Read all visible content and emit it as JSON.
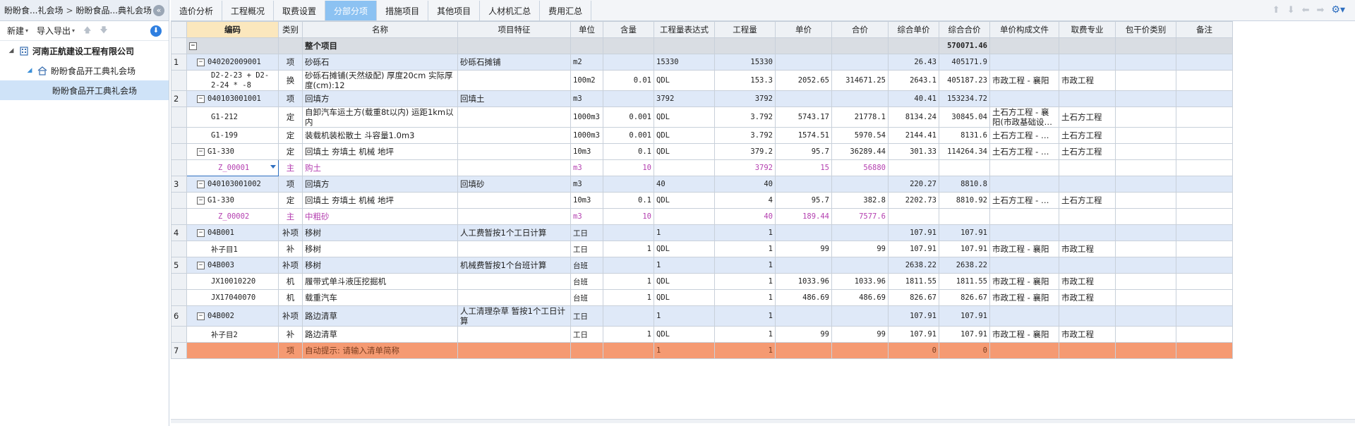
{
  "sidebar": {
    "breadcrumb": [
      "盼盼食...礼会场",
      "盼盼食品...典礼会场"
    ],
    "collapse_icon": "«",
    "toolbar": {
      "new_label": "新建",
      "import_export_label": "导入导出"
    },
    "tree": [
      {
        "label": "河南正航建设工程有限公司",
        "level": 0,
        "icon": "building-icon",
        "expanded": true
      },
      {
        "label": "盼盼食品开工典礼会场",
        "level": 1,
        "icon": "home-icon",
        "expanded": true
      },
      {
        "label": "盼盼食品开工典礼会场",
        "level": 2,
        "icon": "",
        "selected": true
      }
    ]
  },
  "tabs": [
    {
      "label": "造价分析"
    },
    {
      "label": "工程概况"
    },
    {
      "label": "取费设置"
    },
    {
      "label": "分部分项",
      "active": true
    },
    {
      "label": "措施项目"
    },
    {
      "label": "其他项目"
    },
    {
      "label": "人材机汇总"
    },
    {
      "label": "费用汇总"
    }
  ],
  "columns": [
    {
      "key": "rn",
      "label": ""
    },
    {
      "key": "code",
      "label": "编码"
    },
    {
      "key": "type",
      "label": "类别"
    },
    {
      "key": "name",
      "label": "名称"
    },
    {
      "key": "feature",
      "label": "项目特征"
    },
    {
      "key": "unit",
      "label": "单位"
    },
    {
      "key": "content",
      "label": "含量"
    },
    {
      "key": "expr",
      "label": "工程量表达式"
    },
    {
      "key": "qty",
      "label": "工程量"
    },
    {
      "key": "price",
      "label": "单价"
    },
    {
      "key": "total",
      "label": "合价"
    },
    {
      "key": "comp_price",
      "label": "综合单价"
    },
    {
      "key": "comp_total",
      "label": "综合合价"
    },
    {
      "key": "price_file",
      "label": "单价构成文件"
    },
    {
      "key": "fee_major",
      "label": "取费专业"
    },
    {
      "key": "lump_type",
      "label": "包干价类别"
    },
    {
      "key": "remark",
      "label": "备注"
    }
  ],
  "rows": [
    {
      "kind": "root",
      "rn": "",
      "code": "",
      "type": "",
      "name": "整个项目",
      "feature": "",
      "unit": "",
      "content": "",
      "expr": "",
      "qty": "",
      "price": "",
      "total": "",
      "comp_price": "",
      "comp_total": "570071.46",
      "price_file": "",
      "fee_major": ""
    },
    {
      "kind": "item",
      "rn": "1",
      "code": "040202009001",
      "type": "项",
      "name": "砂砾石",
      "feature": "砂砾石摊铺",
      "unit": "m2",
      "content": "",
      "expr": "15330",
      "qty": "15330",
      "price": "",
      "total": "",
      "comp_price": "26.43",
      "comp_total": "405171.9",
      "price_file": "",
      "fee_major": ""
    },
    {
      "kind": "sub",
      "tall": true,
      "rn": "",
      "code": "D2-2-23 + D2-2-24 * -8",
      "type": "换",
      "name": "砂砾石摊铺(天然级配) 厚度20cm  实际厚度(cm):12",
      "feature": "",
      "unit": "100m2",
      "content": "0.01",
      "expr": "QDL",
      "qty": "153.3",
      "price": "2052.65",
      "total": "314671.25",
      "comp_price": "2643.1",
      "comp_total": "405187.23",
      "price_file": "市政工程 - 襄阳",
      "fee_major": "市政工程"
    },
    {
      "kind": "item",
      "rn": "2",
      "code": "040103001001",
      "type": "项",
      "name": "回填方",
      "feature": "回填土",
      "unit": "m3",
      "content": "",
      "expr": "3792",
      "qty": "3792",
      "price": "",
      "total": "",
      "comp_price": "40.41",
      "comp_total": "153234.72",
      "price_file": "",
      "fee_major": ""
    },
    {
      "kind": "sub",
      "tall": true,
      "rn": "",
      "code": "G1-212",
      "type": "定",
      "name": "自卸汽车运土方(载重8t以内) 运距1km以内",
      "feature": "",
      "unit": "1000m3",
      "content": "0.001",
      "expr": "QDL",
      "qty": "3.792",
      "price": "5743.17",
      "total": "21778.1",
      "comp_price": "8134.24",
      "comp_total": "30845.04",
      "price_file": "土石方工程 - 襄阳(市政基础设…",
      "fee_major": "土石方工程"
    },
    {
      "kind": "sub",
      "rn": "",
      "code": "G1-199",
      "type": "定",
      "name": "装载机装松散土 斗容量1.0m3",
      "feature": "",
      "unit": "1000m3",
      "content": "0.001",
      "expr": "QDL",
      "qty": "3.792",
      "price": "1574.51",
      "total": "5970.54",
      "comp_price": "2144.41",
      "comp_total": "8131.6",
      "price_file": "土石方工程 - …",
      "fee_major": "土石方工程"
    },
    {
      "kind": "sub",
      "rn": "",
      "code": "G1-330",
      "type": "定",
      "name": "回填土 夯填土 机械 地坪",
      "feature": "",
      "unit": "10m3",
      "content": "0.1",
      "expr": "QDL",
      "qty": "379.2",
      "price": "95.7",
      "total": "36289.44",
      "comp_price": "301.33",
      "comp_total": "114264.34",
      "price_file": "土石方工程 - …",
      "fee_major": "土石方工程"
    },
    {
      "kind": "mat",
      "editing": true,
      "rn": "",
      "code": "Z_00001",
      "type": "主",
      "name": "购土",
      "feature": "",
      "unit": "m3",
      "content": "10",
      "expr": "",
      "qty": "3792",
      "price": "15",
      "total": "56880",
      "comp_price": "",
      "comp_total": "",
      "price_file": "",
      "fee_major": ""
    },
    {
      "kind": "item",
      "rn": "3",
      "code": "040103001002",
      "type": "项",
      "name": "回填方",
      "feature": "回填砂",
      "unit": "m3",
      "content": "",
      "expr": "40",
      "qty": "40",
      "price": "",
      "total": "",
      "comp_price": "220.27",
      "comp_total": "8810.8",
      "price_file": "",
      "fee_major": ""
    },
    {
      "kind": "sub",
      "rn": "",
      "code": "G1-330",
      "type": "定",
      "name": "回填土 夯填土 机械 地坪",
      "feature": "",
      "unit": "10m3",
      "content": "0.1",
      "expr": "QDL",
      "qty": "4",
      "price": "95.7",
      "total": "382.8",
      "comp_price": "2202.73",
      "comp_total": "8810.92",
      "price_file": "土石方工程 - …",
      "fee_major": "土石方工程"
    },
    {
      "kind": "mat",
      "rn": "",
      "code": "Z_00002",
      "type": "主",
      "name": "中粗砂",
      "feature": "",
      "unit": "m3",
      "content": "10",
      "expr": "",
      "qty": "40",
      "price": "189.44",
      "total": "7577.6",
      "comp_price": "",
      "comp_total": "",
      "price_file": "",
      "fee_major": ""
    },
    {
      "kind": "item",
      "rn": "4",
      "code": "04B001",
      "type": "补项",
      "name": "移树",
      "feature": "人工费暂按1个工日计算",
      "unit": "工日",
      "content": "",
      "expr": "1",
      "qty": "1",
      "price": "",
      "total": "",
      "comp_price": "107.91",
      "comp_total": "107.91",
      "price_file": "",
      "fee_major": ""
    },
    {
      "kind": "sub",
      "rn": "",
      "code": "补子目1",
      "type": "补",
      "name": "移树",
      "feature": "",
      "unit": "工日",
      "content": "1",
      "expr": "QDL",
      "qty": "1",
      "price": "99",
      "total": "99",
      "comp_price": "107.91",
      "comp_total": "107.91",
      "price_file": "市政工程 - 襄阳",
      "fee_major": "市政工程"
    },
    {
      "kind": "item",
      "rn": "5",
      "code": "04B003",
      "type": "补项",
      "name": "移树",
      "feature": "机械费暂按1个台班计算",
      "unit": "台班",
      "content": "",
      "expr": "1",
      "qty": "1",
      "price": "",
      "total": "",
      "comp_price": "2638.22",
      "comp_total": "2638.22",
      "price_file": "",
      "fee_major": ""
    },
    {
      "kind": "sub",
      "rn": "",
      "code": "JX10010220",
      "type": "机",
      "name": "履带式单斗液压挖掘机",
      "feature": "",
      "unit": "台班",
      "content": "1",
      "expr": "QDL",
      "qty": "1",
      "price": "1033.96",
      "total": "1033.96",
      "comp_price": "1811.55",
      "comp_total": "1811.55",
      "price_file": "市政工程 - 襄阳",
      "fee_major": "市政工程"
    },
    {
      "kind": "sub",
      "rn": "",
      "code": "JX17040070",
      "type": "机",
      "name": "载重汽车",
      "feature": "",
      "unit": "台班",
      "content": "1",
      "expr": "QDL",
      "qty": "1",
      "price": "486.69",
      "total": "486.69",
      "comp_price": "826.67",
      "comp_total": "826.67",
      "price_file": "市政工程 - 襄阳",
      "fee_major": "市政工程"
    },
    {
      "kind": "item",
      "tall": true,
      "rn": "6",
      "code": "04B002",
      "type": "补项",
      "name": "路边清草",
      "feature": "人工清理杂草 暂按1个工日计算",
      "unit": "工日",
      "content": "",
      "expr": "1",
      "qty": "1",
      "price": "",
      "total": "",
      "comp_price": "107.91",
      "comp_total": "107.91",
      "price_file": "",
      "fee_major": ""
    },
    {
      "kind": "sub",
      "rn": "",
      "code": "补子目2",
      "type": "补",
      "name": "路边清草",
      "feature": "",
      "unit": "工日",
      "content": "1",
      "expr": "QDL",
      "qty": "1",
      "price": "99",
      "total": "99",
      "comp_price": "107.91",
      "comp_total": "107.91",
      "price_file": "市政工程 - 襄阳",
      "fee_major": "市政工程"
    },
    {
      "kind": "auto",
      "rn": "7",
      "code": "",
      "type": "项",
      "name": "自动提示: 请输入清单简称",
      "feature": "",
      "unit": "",
      "content": "",
      "expr": "1",
      "qty": "1",
      "price": "",
      "total": "",
      "comp_price": "0",
      "comp_total": "0",
      "price_file": "",
      "fee_major": ""
    }
  ]
}
